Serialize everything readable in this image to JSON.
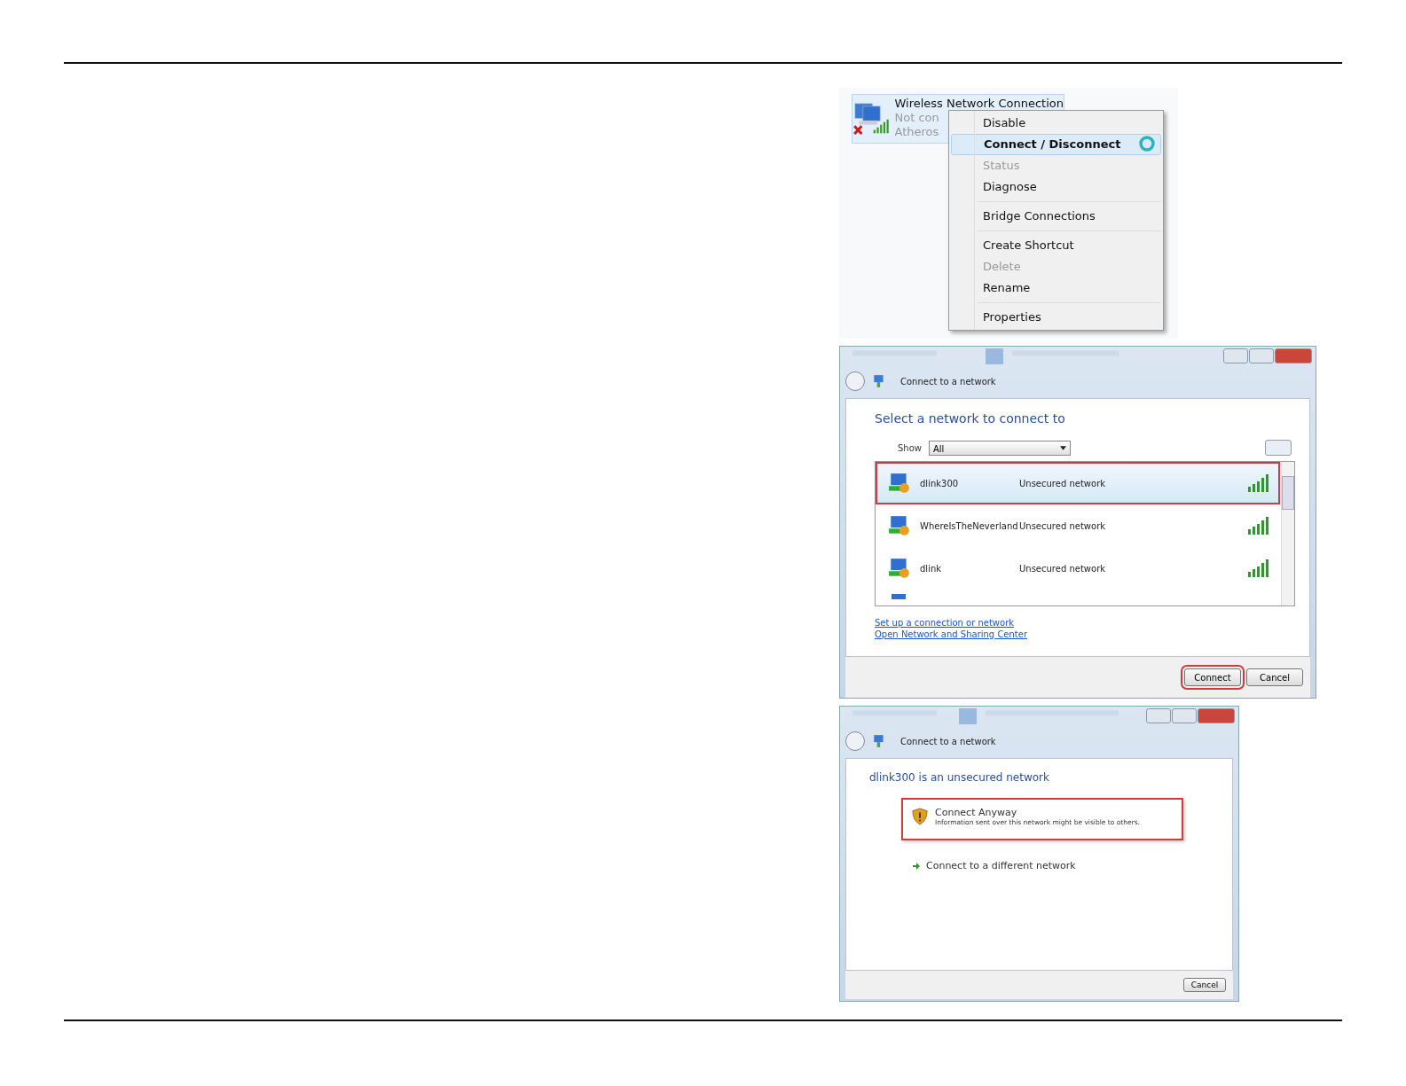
{
  "connection": {
    "name": "Wireless Network Connection",
    "status": "Not con",
    "adapter": "Atheros",
    "connected": false
  },
  "context_menu": {
    "groups": [
      [
        {
          "label": "Disable",
          "disabled": false,
          "selected": false
        },
        {
          "label": "Connect / Disconnect",
          "disabled": false,
          "selected": true
        },
        {
          "label": "Status",
          "disabled": true,
          "selected": false
        },
        {
          "label": "Diagnose",
          "disabled": false,
          "selected": false
        }
      ],
      [
        {
          "label": "Bridge Connections",
          "disabled": false,
          "selected": false
        }
      ],
      [
        {
          "label": "Create Shortcut",
          "disabled": false,
          "selected": false
        },
        {
          "label": "Delete",
          "disabled": true,
          "selected": false
        },
        {
          "label": "Rename",
          "disabled": false,
          "selected": false
        }
      ],
      [
        {
          "label": "Properties",
          "disabled": false,
          "selected": false
        }
      ]
    ]
  },
  "network_dialog": {
    "title": "Connect to a network",
    "heading": "Select a network to connect to",
    "show_label": "Show",
    "show_value": "All",
    "networks": [
      {
        "name": "dlink300",
        "security": "Unsecured network",
        "selected": true,
        "callout": true
      },
      {
        "name": "WhereIsTheNeverland",
        "security": "Unsecured network",
        "selected": false,
        "callout": false
      },
      {
        "name": "dlink",
        "security": "Unsecured network",
        "selected": false,
        "callout": false
      }
    ],
    "links": [
      "Set up a connection or network",
      "Open Network and Sharing Center"
    ],
    "buttons": [
      {
        "label": "Connect",
        "callout": true
      },
      {
        "label": "Cancel",
        "callout": false
      }
    ]
  },
  "warning_dialog": {
    "title": "Connect to a network",
    "heading": "dlink300 is an unsecured network",
    "option": {
      "title": "Connect Anyway",
      "description": "Information sent over this network might be visible to others.",
      "callout": true
    },
    "alternative": "Connect to a different network",
    "buttons": [
      {
        "label": "Cancel",
        "callout": false
      }
    ]
  }
}
